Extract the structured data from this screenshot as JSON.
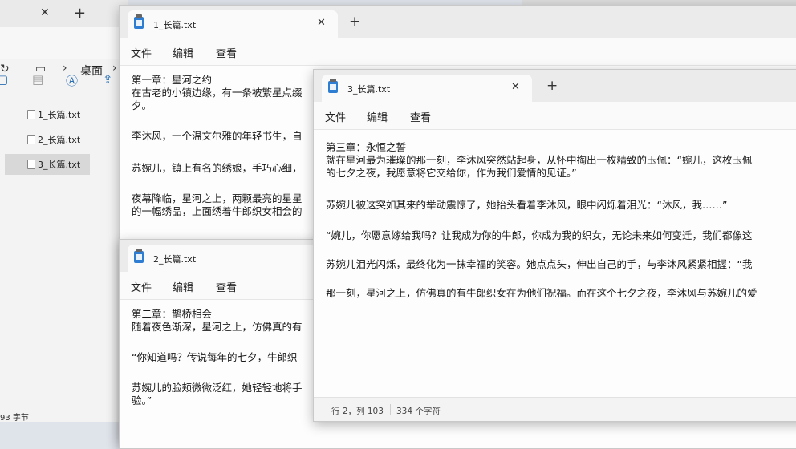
{
  "explorer": {
    "address_sep": "›",
    "address_folder": "桌面",
    "files": [
      {
        "name": "1_长篇.txt"
      },
      {
        "name": "2_长篇.txt"
      },
      {
        "name": "3_长篇.txt",
        "selected": true
      }
    ],
    "status": "93 字节"
  },
  "notepad_menu": {
    "file": "文件",
    "edit": "编辑",
    "view": "查看"
  },
  "window1": {
    "tab_title": "1_长篇.txt",
    "lines": [
      "第一章：星河之约",
      "在古老的小镇边缘，有一条被繁星点缀",
      "夕。",
      "",
      "李沐风，一个温文尔雅的年轻书生，自",
      "",
      "苏婉儿，镇上有名的绣娘，手巧心细，",
      "",
      "夜幕降临，星河之上，两颗最亮的星星",
      "的一幅绣品，上面绣着牛郎织女相会的"
    ]
  },
  "window2": {
    "tab_title": "2_长篇.txt",
    "lines": [
      "第二章：鹊桥相会",
      "随着夜色渐深，星河之上，仿佛真的有",
      "",
      "“你知道吗？传说每年的七夕，牛郎织",
      "",
      "苏婉儿的脸颊微微泛红，她轻轻地将手",
      "验。”"
    ]
  },
  "window3": {
    "tab_title": "3_长篇.txt",
    "lines": [
      "第三章：永恒之誓",
      "就在星河最为璀璨的那一刻，李沐风突然站起身，从怀中掏出一枚精致的玉佩：“婉儿，这枚玉佩",
      "的七夕之夜，我愿意将它交给你，作为我们爱情的见证。”",
      "",
      "苏婉儿被这突如其来的举动震惊了，她抬头看着李沐风，眼中闪烁着泪光：“沐风，我……”",
      "",
      "“婉儿，你愿意嫁给我吗？让我成为你的牛郎，你成为我的织女，无论未来如何变迁，我们都像这",
      "",
      "苏婉儿泪光闪烁，最终化为一抹幸福的笑容。她点点头，伸出自己的手，与李沐风紧紧相握：“我",
      "",
      "那一刻，星河之上，仿佛真的有牛郎织女在为他们祝福。而在这个七夕之夜，李沐风与苏婉儿的爱"
    ],
    "status_position": "行 2，列 103",
    "status_chars": "334 个字符"
  }
}
